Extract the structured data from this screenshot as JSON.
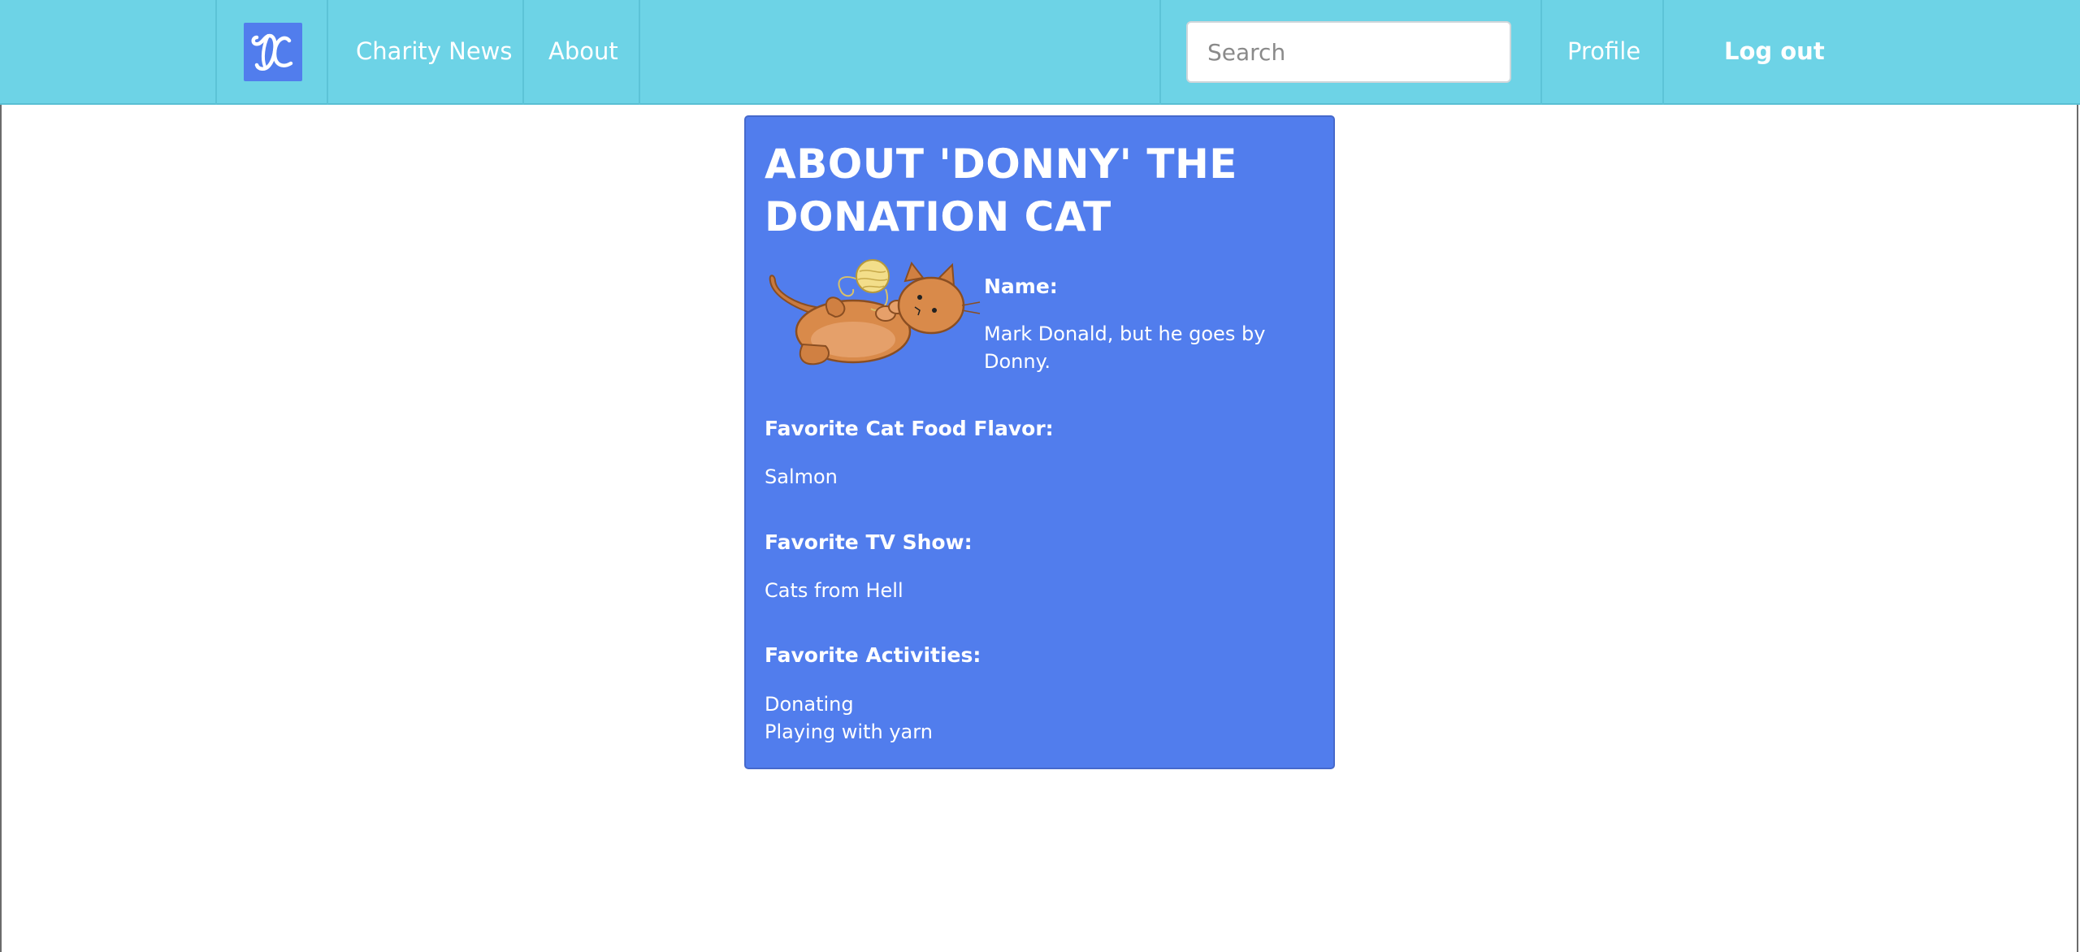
{
  "nav": {
    "logo_text": "DC",
    "links": [
      "Charity News",
      "About"
    ],
    "search_placeholder": "Search",
    "search_value": "",
    "profile_label": "Profile",
    "logout_label": "Log out"
  },
  "card": {
    "title": "ABOUT 'DONNY' THE DONATION CAT",
    "image_alt": "cat-playing-with-yarn",
    "fields": [
      {
        "label": "Name:",
        "value": "Mark Donald, but he goes by Donny."
      },
      {
        "label": "Favorite Cat Food Flavor:",
        "value": "Salmon"
      },
      {
        "label": "Favorite TV Show:",
        "value": "Cats from Hell"
      },
      {
        "label": "Favorite Activities:",
        "values": [
          "Donating",
          "Playing with yarn"
        ]
      }
    ]
  },
  "colors": {
    "navbar": "#6dd3e6",
    "card": "#517ded",
    "logo_bg": "#517ded",
    "text_on_dark": "#ffffff"
  }
}
